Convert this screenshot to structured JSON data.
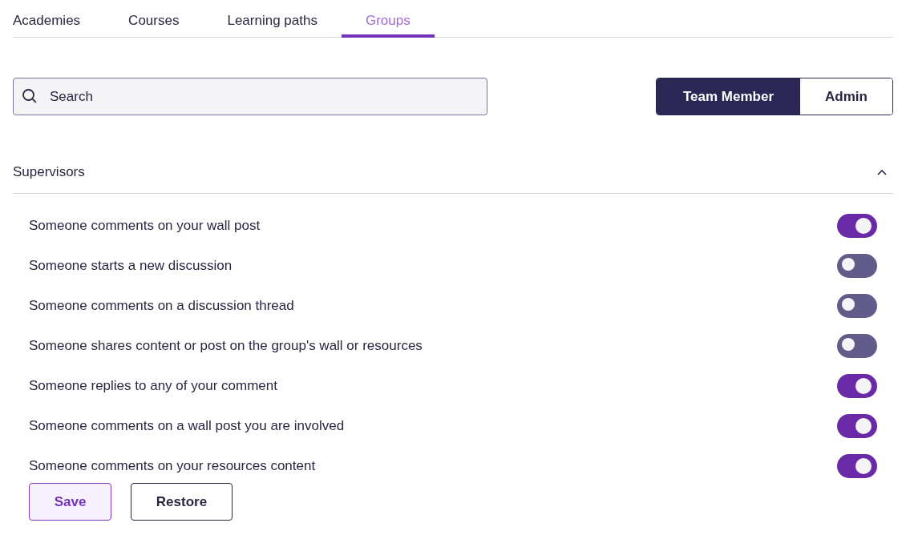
{
  "tabs": [
    {
      "label": "Academies",
      "selected": false
    },
    {
      "label": "Courses",
      "selected": false
    },
    {
      "label": "Learning paths",
      "selected": false
    },
    {
      "label": "Groups",
      "selected": true
    }
  ],
  "search": {
    "placeholder": "Search"
  },
  "roles": [
    {
      "label": "Team Member",
      "selected": true
    },
    {
      "label": "Admin",
      "selected": false
    }
  ],
  "section": {
    "title": "Supervisors",
    "expanded": true
  },
  "settings": [
    {
      "label": "Someone comments on your wall post",
      "on": true
    },
    {
      "label": "Someone starts a new discussion",
      "on": false
    },
    {
      "label": "Someone comments on a discussion thread",
      "on": false
    },
    {
      "label": "Someone shares content or post on the group's wall or resources",
      "on": false
    },
    {
      "label": "Someone replies to any of your comment",
      "on": true
    },
    {
      "label": "Someone comments on a wall post you are involved",
      "on": true
    },
    {
      "label": "Someone comments on your resources content",
      "on": true
    }
  ],
  "buttons": [
    {
      "label": "Save",
      "kind": "primary"
    },
    {
      "label": "Restore",
      "kind": "secondary"
    }
  ]
}
